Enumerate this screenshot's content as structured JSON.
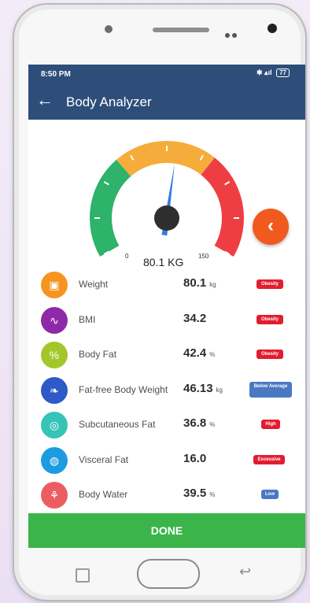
{
  "status_bar": {
    "time": "8:50 PM",
    "icons": "✱ ▴ıl",
    "battery": "77"
  },
  "app_bar": {
    "back_icon": "arrow-left-icon",
    "title": "Body Analyzer"
  },
  "gauge": {
    "min_label": "0",
    "max_label": "150",
    "reading": "80.1 KG",
    "value": 80.1,
    "range": [
      0,
      150
    ],
    "colors": {
      "green": "#2db36a",
      "orange": "#f6ac3b",
      "red": "#ef3e43",
      "needle": "#2f7fe0",
      "hub": "#2e2e2e"
    }
  },
  "fab": {
    "label": "‹"
  },
  "metrics": [
    {
      "name": "Weight",
      "value": "80.1",
      "unit": "kg",
      "badge": "Obesity",
      "badge_color": "red",
      "icon_color": "#f6941f",
      "icon": "weight-icon",
      "glyph": "▣"
    },
    {
      "name": "BMI",
      "value": "34.2",
      "unit": "",
      "badge": "Obesity",
      "badge_color": "red",
      "icon_color": "#8e2aa8",
      "icon": "pulse-icon",
      "glyph": "∿"
    },
    {
      "name": "Body Fat",
      "value": "42.4",
      "unit": "%",
      "badge": "Obesity",
      "badge_color": "red",
      "icon_color": "#a3c728",
      "icon": "percent-icon",
      "glyph": "%"
    },
    {
      "name": "Fat-free Body Weight",
      "value": "46.13",
      "unit": "kg",
      "badge": "Below Average",
      "badge_color": "blue",
      "icon_color": "#2c5ac7",
      "icon": "leaf-icon",
      "glyph": "❧"
    },
    {
      "name": "Subcutaneous Fat",
      "value": "36.8",
      "unit": "%",
      "badge": "High",
      "badge_color": "red",
      "icon_color": "#36c4b8",
      "icon": "fat-cell-icon",
      "glyph": "◎"
    },
    {
      "name": "Visceral Fat",
      "value": "16.0",
      "unit": "",
      "badge": "Excessive",
      "badge_color": "red",
      "icon_color": "#1d9be0",
      "icon": "organ-icon",
      "glyph": "◍"
    },
    {
      "name": "Body Water",
      "value": "39.5",
      "unit": "%",
      "badge": "Low",
      "badge_color": "blue",
      "icon_color": "#ec5d62",
      "icon": "water-drop-icon",
      "glyph": "⚘"
    }
  ],
  "done_button": {
    "label": "DONE"
  },
  "nav": {
    "recent_icon": "recent-apps-icon",
    "home_icon": "home-button-icon",
    "back_icon": "back-arrow-icon",
    "back_glyph": "↩"
  }
}
